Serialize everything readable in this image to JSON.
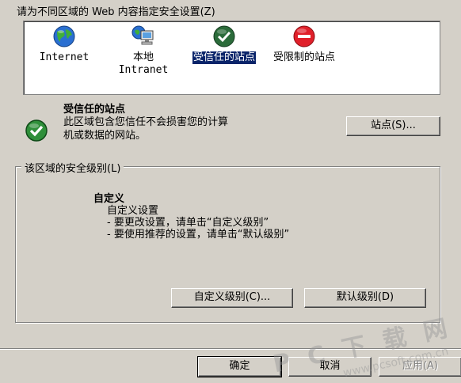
{
  "instruction": "请为不同区域的 Web 内容指定安全设置(Z)",
  "zones": [
    {
      "label": "Internet",
      "icon": "globe-icon"
    },
    {
      "label": "本地\nIntranet",
      "icon": "intranet-icon"
    },
    {
      "label": "受信任的站点",
      "icon": "trusted-check-icon",
      "selected": true
    },
    {
      "label": "受限制的站点",
      "icon": "restricted-icon"
    }
  ],
  "selected_zone": {
    "title": "受信任的站点",
    "description_line1": "此区域包含您信任不会损害您的计算",
    "description_line2": "机或数据的网站。",
    "sites_button": "站点(S)..."
  },
  "security_level": {
    "group_title": "该区域的安全级别(L)",
    "level_name": "自定义",
    "line1": "自定义设置",
    "line2": "- 要更改设置，请单击“自定义级别”",
    "line3": "- 要使用推荐的设置，请单击“默认级别”",
    "custom_button": "自定义级别(C)...",
    "default_button": "默认级别(D)"
  },
  "footer": {
    "ok": "确定",
    "cancel": "取消",
    "apply": "应用(A)"
  },
  "watermark": {
    "main": "P C 下 载 网",
    "sub": "www.pcsoft.com.cn"
  },
  "colors": {
    "dialog_bg": "#d4d0c8",
    "selection": "#0a246a",
    "trusted_green": "#2b6b3a",
    "restricted_red": "#e0202a"
  }
}
